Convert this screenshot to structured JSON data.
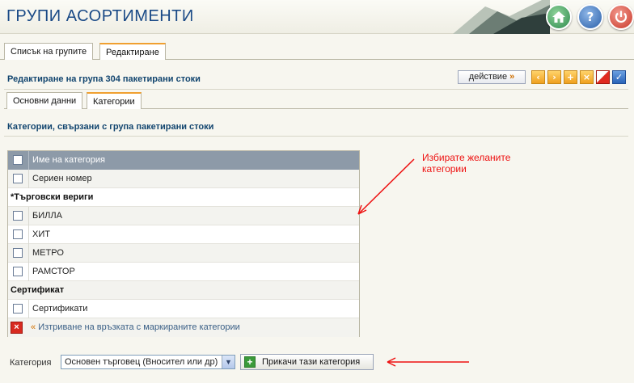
{
  "header": {
    "title": "ГРУПИ АСОРТИМЕНТИ",
    "home_icon": "home-icon",
    "help_icon": "help-icon",
    "power_icon": "power-icon",
    "help_glyph": "?"
  },
  "main_tabs": [
    {
      "label": "Списък на групите"
    },
    {
      "label": "Редактиране"
    }
  ],
  "edit": {
    "title": "Редактиране на група 304 пакетирани стоки",
    "action_label": "действие",
    "action_arrow": "»"
  },
  "sub_tabs": [
    {
      "label": "Основни данни"
    },
    {
      "label": "Категории"
    }
  ],
  "categories_section": {
    "title": "Категории, свързани с група пакетирани стоки"
  },
  "grid": {
    "header": "Име на категория",
    "rows": [
      {
        "type": "item",
        "label": "Сериен номер"
      },
      {
        "type": "group",
        "label": "*Търговски вериги"
      },
      {
        "type": "item",
        "label": "БИЛЛА"
      },
      {
        "type": "item",
        "label": "ХИТ"
      },
      {
        "type": "item",
        "label": "МЕТРО"
      },
      {
        "type": "item",
        "label": "РАМСТОР"
      },
      {
        "type": "group",
        "label": "Сертификат"
      },
      {
        "type": "item",
        "label": "Сертификати"
      }
    ],
    "delete_link_prefix": "«",
    "delete_link": "Изтриване на връзката с маркираните категории"
  },
  "annotation": {
    "line1": "Избирате желаните",
    "line2": "категории"
  },
  "bottom_form": {
    "category_label": "Категория",
    "category_value": "Основен търговец (Вносител или др)",
    "attach_label": "Прикачи тази категория"
  },
  "colors": {
    "accent": "#1a4a86",
    "annotation": "#e11111",
    "grid_header": "#8d9aa8"
  }
}
